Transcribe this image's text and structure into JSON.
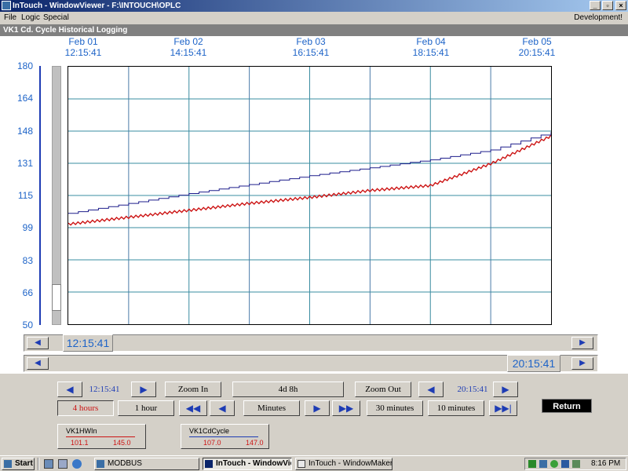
{
  "window": {
    "title": "InTouch - WindowViewer - F:\\INTOUCH\\OPLC",
    "right_label": "Development!"
  },
  "menu": [
    "File",
    "Logic",
    "Special"
  ],
  "subtitle": "VK1 Cd. Cycle Historical Logging",
  "chart_data": {
    "type": "line",
    "x_tick_dates": [
      "Feb 01",
      "Feb 02",
      "Feb 03",
      "Feb 04",
      "Feb 05"
    ],
    "x_tick_times": [
      "12:15:41",
      "14:15:41",
      "16:15:41",
      "18:15:41",
      "20:15:41"
    ],
    "y_ticks": [
      "180",
      "164",
      "148",
      "131",
      "115",
      "99",
      "83",
      "66",
      "50"
    ],
    "ylim": [
      50,
      180
    ],
    "grid": true,
    "x_hours": [
      0,
      1,
      2,
      3,
      4,
      5,
      6,
      7,
      8
    ],
    "series": [
      {
        "name": "VK1HWIn",
        "color": "#cc1414",
        "values": [
          100.5,
          104,
          107.5,
          111,
          114,
          117.5,
          120,
          131,
          145
        ]
      },
      {
        "name": "VK1CdCycle",
        "color": "#1e1e8c",
        "values": [
          106,
          111,
          116,
          120.5,
          125,
          129,
          133,
          138,
          147
        ]
      }
    ]
  },
  "hscroll": {
    "start_time": "12:15:41",
    "end_time": "20:15:41"
  },
  "controls": {
    "left_time": "12:15:41",
    "right_time": "20:15:41",
    "zoom_in": "Zoom In",
    "span": "4d 8h",
    "zoom_out": "Zoom Out",
    "btn_4hours": "4 hours",
    "btn_1hour": "1 hour",
    "btn_minutes": "Minutes",
    "btn_30min": "30 minutes",
    "btn_10min": "10 minutes",
    "return": "Return"
  },
  "pens": [
    {
      "name": "VK1HWIn",
      "min": "101.1",
      "max": "145.0",
      "color": "#cc1414"
    },
    {
      "name": "VK1CdCycle",
      "min": "107.0",
      "max": "147.0",
      "color": "#1e3cb4"
    }
  ],
  "taskbar": {
    "start": "Start",
    "items": [
      "MODBUS",
      "InTouch - WindowViewer...",
      "InTouch - WindowMaker -..."
    ],
    "clock": "8:16 PM"
  }
}
